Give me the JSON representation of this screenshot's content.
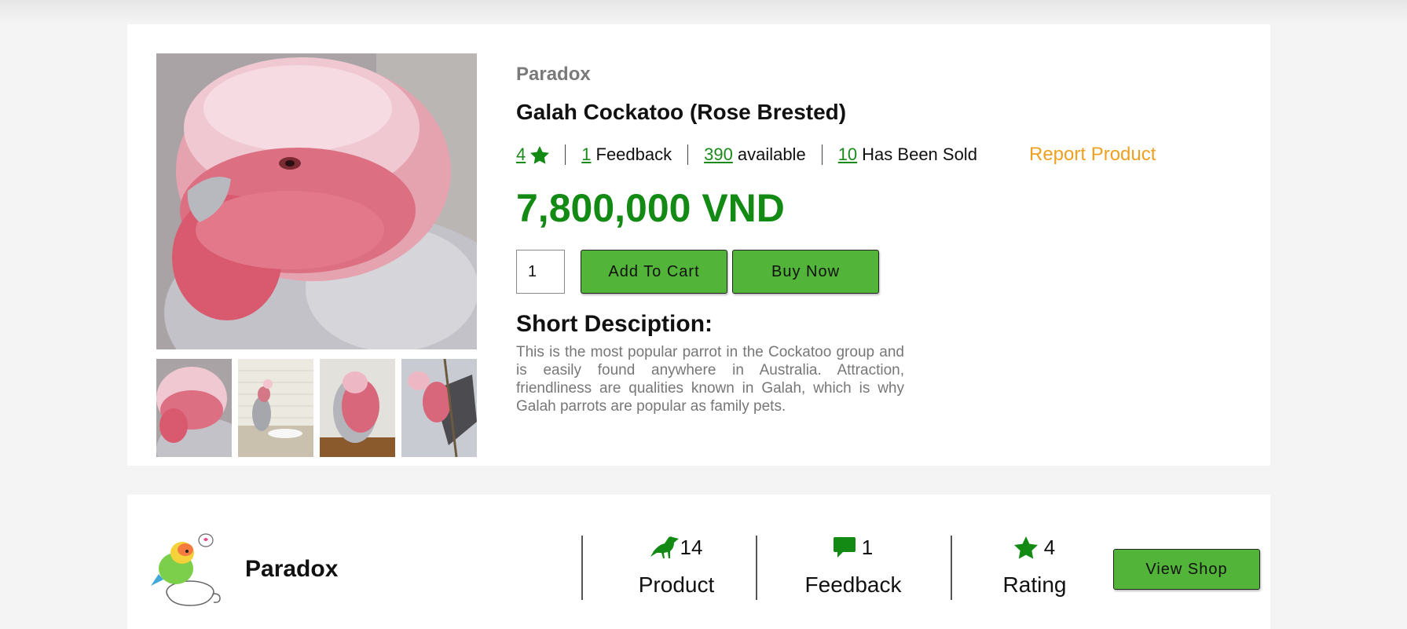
{
  "product": {
    "shop_name": "Paradox",
    "title": "Galah Cockatoo (Rose Brested)",
    "rating": "4",
    "feedback_count": "1",
    "feedback_label": "Feedback",
    "available_count": "390",
    "available_label": "available",
    "sold_count": "10",
    "sold_label": "Has Been Sold",
    "report_label": "Report Product",
    "price": "7,800,000 VND",
    "quantity": "1",
    "add_to_cart_label": "Add To Cart",
    "buy_now_label": "Buy Now",
    "desc_title": "Short Desciption:",
    "desc_text": "This is the most popular parrot in the Cockatoo group and is easily found anywhere in Australia. Attraction, friendliness are qualities known in Galah, which is why Galah parrots are popular as family pets."
  },
  "shop": {
    "name": "Paradox",
    "product_count": "14",
    "product_label": "Product",
    "feedback_count": "1",
    "feedback_label": "Feedback",
    "rating": "4",
    "rating_label": "Rating",
    "view_shop_label": "View Shop"
  },
  "colors": {
    "accent_green": "#52b438",
    "price_green": "#138a13",
    "report_orange": "#f0a020"
  }
}
